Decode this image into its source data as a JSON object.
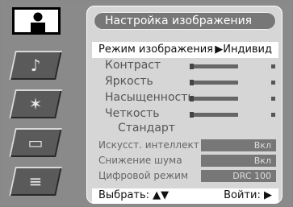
{
  "menu": {
    "title": "Настройка изображения",
    "mode": {
      "label": "Режим изображения",
      "arrow": "▶",
      "value": "Индивид"
    },
    "adjustments": [
      {
        "label": "Контраст"
      },
      {
        "label": "Яркость"
      },
      {
        "label": "Насыщенность"
      },
      {
        "label": "Четкость"
      }
    ],
    "standard_label": "Стандарт",
    "options": [
      {
        "label": "Искусст. интеллект",
        "value": "Вкл"
      },
      {
        "label": "Снижение шума",
        "value": "Вкл"
      },
      {
        "label": "Цифровой режим",
        "value": "DRC 100"
      }
    ],
    "nav": {
      "select": "Выбрать: ▲▼",
      "enter": "Войти: ▶"
    }
  },
  "sidebar": {
    "icons": [
      "person-icon",
      "music-note-icon",
      "stars-icon",
      "briefcase-icon",
      "document-icon"
    ]
  },
  "colors": {
    "panel": "#d6d6d6",
    "title_bg": "#777777",
    "highlight": "#ffffff",
    "background": "#8a8a8a"
  }
}
